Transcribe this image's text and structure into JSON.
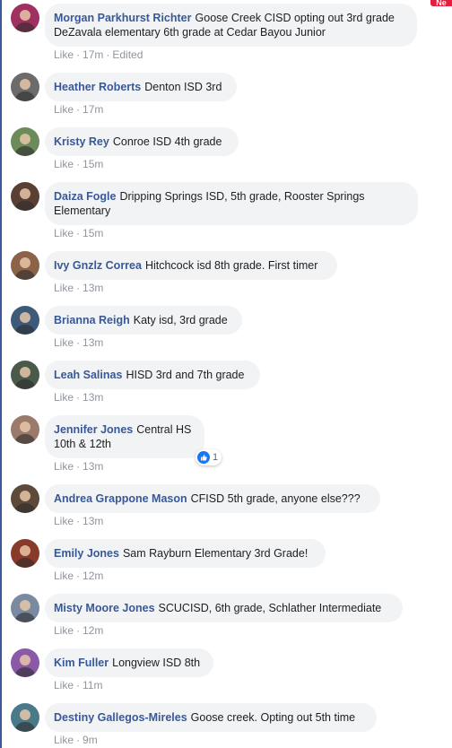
{
  "corner_badge": "Ne",
  "like_label": "Like",
  "separator": "·",
  "comments": [
    {
      "author": "Morgan Parkhurst Richter",
      "text_line1": "Goose Creek CISD opting out 3rd grade",
      "text_line2": "DeZavala elementary 6th grade at Cedar Bayou Junior",
      "time": "17m",
      "edited": "Edited",
      "avatar_color": "#a03060"
    },
    {
      "author": "Heather Roberts",
      "text_line1": "Denton ISD 3rd",
      "time": "17m",
      "avatar_color": "#6b6b6b"
    },
    {
      "author": "Kristy Rey",
      "text_line1": "Conroe ISD 4th grade",
      "time": "15m",
      "avatar_color": "#6d8a5a"
    },
    {
      "author": "Daiza Fogle",
      "text_line1": "Dripping Springs ISD, 5th grade, Rooster Springs",
      "text_line2": "Elementary",
      "time": "15m",
      "avatar_color": "#5a3f33"
    },
    {
      "author": "Ivy Gnzlz Correa",
      "text_line1": "Hitchcock isd 8th grade. First timer",
      "time": "13m",
      "avatar_color": "#8c6248"
    },
    {
      "author": "Brianna Reigh",
      "text_line1": "Katy isd, 3rd grade",
      "time": "13m",
      "avatar_color": "#3e5a7a"
    },
    {
      "author": "Leah Salinas",
      "text_line1": "HISD 3rd and 7th grade",
      "time": "13m",
      "avatar_color": "#4a5a4a"
    },
    {
      "author": "Jennifer Jones",
      "text_line1": "Central HS",
      "text_line2": "10th & 12th",
      "time": "13m",
      "reaction_count": "1",
      "avatar_color": "#9a7a6a"
    },
    {
      "author": "Andrea Grappone Mason",
      "text_line1": "CFISD 5th grade, anyone else???",
      "time": "13m",
      "avatar_color": "#5e4a3a"
    },
    {
      "author": "Emily Jones",
      "text_line1": "Sam Rayburn Elementary 3rd Grade!",
      "time": "12m",
      "avatar_color": "#8a3a2a"
    },
    {
      "author": "Misty Moore Jones",
      "text_line1": "SCUCISD, 6th grade, Schlather Intermediate",
      "time": "12m",
      "avatar_color": "#7a8aa0"
    },
    {
      "author": "Kim Fuller",
      "text_line1": "Longview ISD 8th",
      "time": "11m",
      "avatar_color": "#8a5aa8"
    },
    {
      "author": "Destiny Gallegos-Mireles",
      "text_line1": "Goose creek. Opting out 5th time",
      "time": "9m",
      "avatar_color": "#4a7a8a"
    }
  ]
}
